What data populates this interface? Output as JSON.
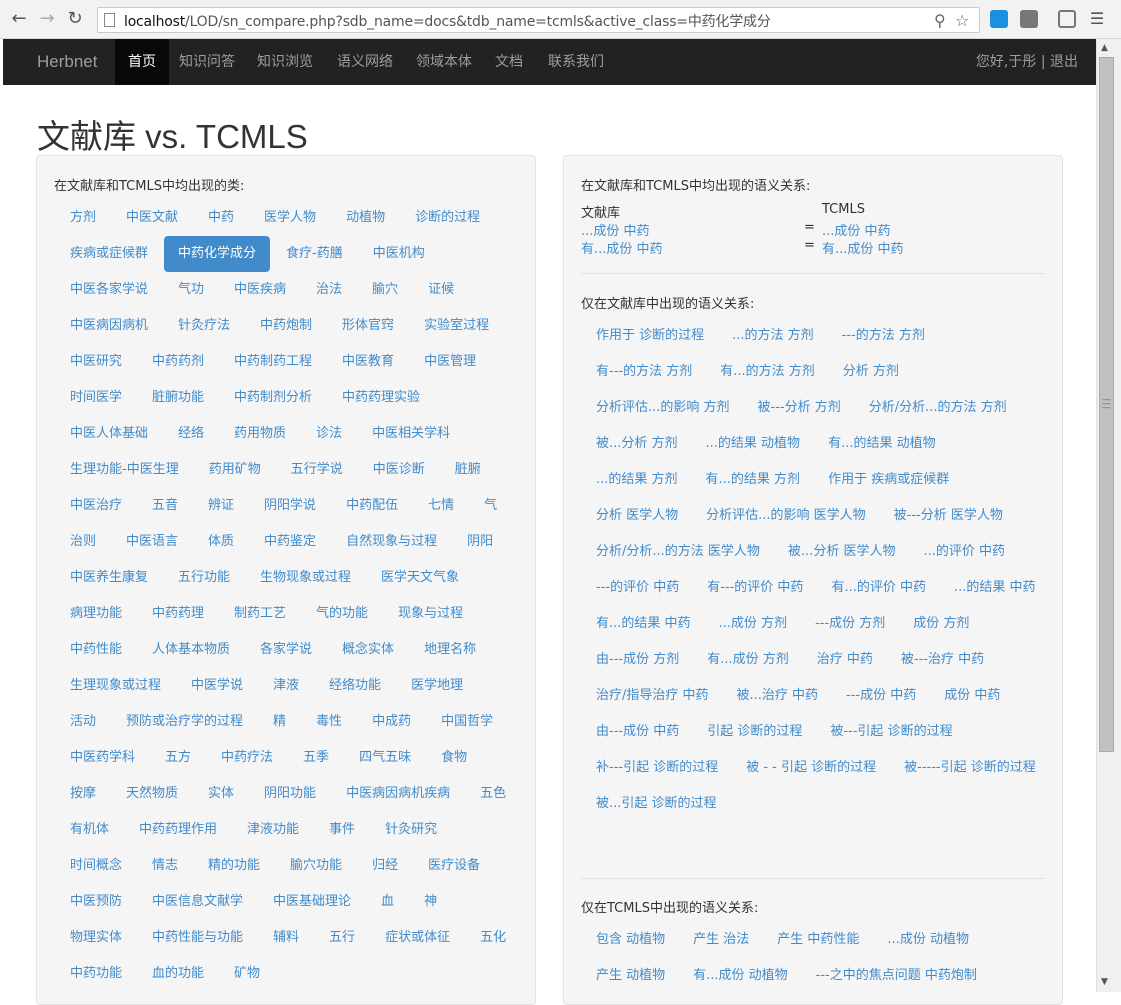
{
  "browser": {
    "url_prefix": "localhost",
    "url_rest": "/LOD/sn_compare.php?sdb_name=docs&tdb_name=tcmls&active_class=中药化学成分"
  },
  "navbar": {
    "brand": "Herbnet",
    "items": [
      "首页",
      "知识问答",
      "知识浏览",
      "语义网络",
      "领域本体",
      "文档",
      "联系我们"
    ],
    "active_index": 0,
    "greeting": "您好,于彤 | 退出"
  },
  "page": {
    "title": "文献库 vs. TCMLS"
  },
  "left_panel": {
    "title": "在文献库和TCMLS中均出现的类:",
    "active_class": "中药化学成分",
    "classes": [
      "方剂",
      "中医文献",
      "中药",
      "医学人物",
      "动植物",
      "诊断的过程",
      "疾病或症候群",
      "中药化学成分",
      "食疗-药膳",
      "中医机构",
      "中医各家学说",
      "气功",
      "中医疾病",
      "治法",
      "腧穴",
      "证候",
      "中医病因病机",
      "针灸疗法",
      "中药炮制",
      "形体官窍",
      "实验室过程",
      "中医研究",
      "中药药剂",
      "中药制药工程",
      "中医教育",
      "中医管理",
      "时间医学",
      "脏腑功能",
      "中药制剂分析",
      "中药药理实验",
      "中医人体基础",
      "经络",
      "药用物质",
      "诊法",
      "中医相关学科",
      "生理功能-中医生理",
      "药用矿物",
      "五行学说",
      "中医诊断",
      "脏腑",
      "中医治疗",
      "五音",
      "辨证",
      "阴阳学说",
      "中药配伍",
      "七情",
      "气",
      "治则",
      "中医语言",
      "体质",
      "中药鉴定",
      "自然现象与过程",
      "阴阳",
      "中医养生康复",
      "五行功能",
      "生物现象或过程",
      "医学天文气象",
      "病理功能",
      "中药药理",
      "制药工艺",
      "气的功能",
      "现象与过程",
      "中药性能",
      "人体基本物质",
      "各家学说",
      "概念实体",
      "地理名称",
      "生理现象或过程",
      "中医学说",
      "津液",
      "经络功能",
      "医学地理",
      "活动",
      "预防或治疗学的过程",
      "精",
      "毒性",
      "中成药",
      "中国哲学",
      "中医药学科",
      "五方",
      "中药疗法",
      "五季",
      "四气五味",
      "食物",
      "按摩",
      "天然物质",
      "实体",
      "阴阳功能",
      "中医病因病机疾病",
      "五色",
      "有机体",
      "中药药理作用",
      "津液功能",
      "事件",
      "针灸研究",
      "时间概念",
      "情志",
      "精的功能",
      "腧穴功能",
      "归经",
      "医疗设备",
      "中医预防",
      "中医信息文献学",
      "中医基础理论",
      "血",
      "神",
      "物理实体",
      "中药性能与功能",
      "辅料",
      "五行",
      "症状或体征",
      "五化",
      "中药功能",
      "血的功能",
      "矿物"
    ]
  },
  "right_panel": {
    "common_title": "在文献库和TCMLS中均出现的语义关系:",
    "col_left_header": "文献库",
    "col_right_header": "TCMLS",
    "common_rows": [
      {
        "left": "...成份 中药",
        "eq": "=",
        "right": "...成份 中药"
      },
      {
        "left": "有...成份 中药",
        "eq": "=",
        "right": "有...成份 中药"
      }
    ],
    "docs_only_title": "仅在文献库中出现的语义关系:",
    "docs_only": [
      "作用于 诊断的过程",
      "...的方法 方剂",
      "---的方法 方剂",
      "有---的方法 方剂",
      "有...的方法 方剂",
      "分析 方剂",
      "分析评估...的影响 方剂",
      "被---分析 方剂",
      "分析/分析...的方法 方剂",
      "被...分析 方剂",
      "...的结果 动植物",
      "有...的结果 动植物",
      "...的结果 方剂",
      "有...的结果 方剂",
      "作用于 疾病或症候群",
      "分析 医学人物",
      "分析评估...的影响 医学人物",
      "被---分析 医学人物",
      "分析/分析...的方法 医学人物",
      "被...分析 医学人物",
      "...的评价 中药",
      "---的评价 中药",
      "有---的评价 中药",
      "有...的评价 中药",
      "...的结果 中药",
      "有...的结果 中药",
      "...成份 方剂",
      "---成份 方剂",
      "成份 方剂",
      "由---成份 方剂",
      "有...成份 方剂",
      "治疗 中药",
      "被---治疗 中药",
      "治疗/指导治疗 中药",
      "被...治疗 中药",
      "---成份 中药",
      "成份 中药",
      "由---成份 中药",
      "引起 诊断的过程",
      "被---引起 诊断的过程",
      "补---引起 诊断的过程",
      "被 -  - 引起 诊断的过程",
      "被-----引起 诊断的过程",
      "被...引起 诊断的过程"
    ],
    "tcmls_only_title": "仅在TCMLS中出现的语义关系:",
    "tcmls_only": [
      "包含 动植物",
      "产生 治法",
      "产生 中药性能",
      "...成份 动植物",
      "产生 动植物",
      "有...成份 动植物",
      "---之中的焦点问题 中药炮制"
    ]
  }
}
